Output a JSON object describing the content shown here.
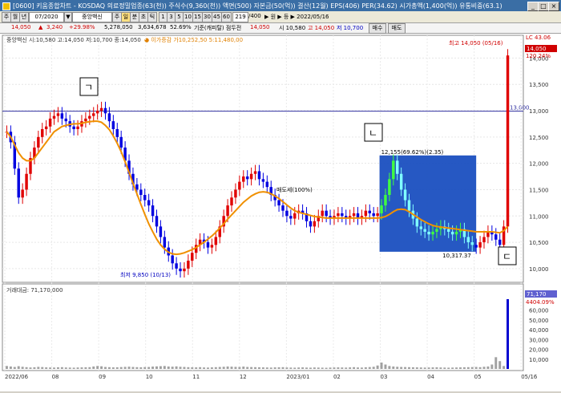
{
  "window": {
    "title": "[0600] 키움종합차트 - KOSDAQ 의료정밀업종(63(천)) 주식수(9,360(천)) 액면(500) 자본금(50(억)) 결산(12월) EPS(406) PER(34.62) 시가총액(1,400(억)) 유통비중(63.1)",
    "buttons": [
      "_",
      "□",
      "×"
    ]
  },
  "toolbar": {
    "period_buttons": [
      "주",
      "월",
      "년"
    ],
    "date": "07/2020",
    "stock_name": "중앙백신",
    "mode_buttons": [
      "주",
      "일",
      "분",
      "초",
      "틱"
    ],
    "minute_buttons": [
      "1",
      "3",
      "5",
      "10",
      "15",
      "30",
      "45",
      "60"
    ],
    "count": "219",
    "count_total": "/400",
    "info": "▶ 원 ▶ 등 ▶ 2022/05/16"
  },
  "pricebar": {
    "last": "14,050",
    "change": "3,240",
    "change_pct": "+29.98%",
    "volume": "5,278,050",
    "amount": "3,634,678",
    "rate": "52.69%",
    "ref_label": "기준(캐피탈) 점두전",
    "hi_label": "14,050",
    "open": "시 10,580",
    "high": "고 14,050",
    "low": "저 10,700",
    "btn1": "매수",
    "btn2": "매도"
  },
  "legend": {
    "price": "중앙백신 시:10,580 고:14,050 저:10,700 종:14,050",
    "ma": "● 이가증감 가10,252,50  5:11,480,00",
    "volume": "거래대금: 71,170,000"
  },
  "chart_data": {
    "type": "candlestick",
    "x_ticks": [
      "2022/06",
      "08",
      "09",
      "10",
      "11",
      "12",
      "2023/01",
      "02",
      "03",
      "04",
      "05",
      "05/16"
    ],
    "y_ticks": [
      "10,000",
      "10,500",
      "11,000",
      "11,500",
      "12,000",
      "12,500",
      "13,000",
      "13,500",
      "14,000"
    ],
    "ylim": [
      9800,
      14250
    ],
    "volume_ticks": [
      "10,000",
      "20,000",
      "30,000",
      "40,000",
      "50,000",
      "60,000"
    ],
    "volume_ylim": [
      0,
      72000
    ],
    "hline": {
      "value": 12990,
      "label": "13,000"
    },
    "annotations": {
      "high": "최고 14,050 (05/16)",
      "low": "최저 9,850 (10/13)",
      "rect_top": "12,155(69.62%)(2.35)",
      "rect_bottom": "10,317.37",
      "mid_label": "매도세(100%)",
      "corner1": "ㄱ",
      "corner2": "ㄴ",
      "corner3": "ㄷ",
      "right_top1": "LC 43.06",
      "right_top2": "14,050",
      "right_top3": "120.24%",
      "vol_right1": "71,170",
      "vol_right2": "4404.09%"
    },
    "closes": [
      12600,
      12400,
      11900,
      11350,
      11500,
      11800,
      12100,
      12300,
      12500,
      12650,
      12700,
      12850,
      12900,
      12950,
      12850,
      12800,
      12700,
      12650,
      12700,
      12800,
      12850,
      12900,
      12950,
      13000,
      13050,
      12950,
      12800,
      12650,
      12500,
      12300,
      12050,
      11800,
      11600,
      11500,
      11400,
      11300,
      11200,
      11000,
      10800,
      10600,
      10400,
      10250,
      10100,
      10000,
      9950,
      10000,
      10150,
      10300,
      10450,
      10550,
      10500,
      10400,
      10450,
      10600,
      10800,
      11000,
      11200,
      11350,
      11500,
      11650,
      11750,
      11700,
      11800,
      11850,
      11700,
      11650,
      11550,
      11400,
      11300,
      11200,
      11100,
      11000,
      10950,
      11050,
      11100,
      11050,
      10900,
      10800,
      10900,
      11000,
      11100,
      11000,
      10950,
      11000,
      11050,
      11000,
      10950,
      11000,
      11050,
      10950,
      11000,
      11100,
      11050,
      11000,
      11050,
      11200,
      11400,
      11700,
      12050,
      11800,
      11500,
      11300,
      11100,
      10950,
      10800,
      10750,
      10700,
      10650,
      10700,
      10750,
      10800,
      10750,
      10700,
      10650,
      10700,
      10750,
      10600,
      10500,
      10450,
      10400,
      10500,
      10600,
      10700,
      10650,
      10550,
      10450,
      10800,
      14050
    ],
    "ma": [
      12600,
      12500,
      12350,
      12200,
      12100,
      12050,
      12050,
      12100,
      12200,
      12300,
      12400,
      12500,
      12600,
      12650,
      12700,
      12720,
      12740,
      12750,
      12750,
      12760,
      12780,
      12790,
      12800,
      12800,
      12780,
      12720,
      12640,
      12520,
      12380,
      12220,
      12030,
      11830,
      11620,
      11420,
      11220,
      11030,
      10850,
      10700,
      10560,
      10450,
      10370,
      10310,
      10280,
      10270,
      10280,
      10300,
      10330,
      10360,
      10400,
      10450,
      10500,
      10560,
      10620,
      10690,
      10770,
      10850,
      10940,
      11020,
      11100,
      11180,
      11260,
      11320,
      11380,
      11420,
      11450,
      11460,
      11450,
      11420,
      11380,
      11330,
      11270,
      11210,
      11150,
      11100,
      11070,
      11050,
      11030,
      11010,
      10990,
      10980,
      10970,
      10960,
      10960,
      10960,
      10960,
      10960,
      10960,
      10960,
      10960,
      10960,
      10960,
      10960,
      10960,
      10960,
      10960,
      10970,
      10990,
      11030,
      11080,
      11120,
      11130,
      11120,
      11080,
      11030,
      10980,
      10930,
      10890,
      10850,
      10820,
      10800,
      10790,
      10780,
      10770,
      10760,
      10750,
      10740,
      10730,
      10720,
      10710,
      10700,
      10700,
      10700,
      10700,
      10700,
      10690,
      10680,
      10720,
      10800
    ],
    "volumes": [
      3000,
      2500,
      2000,
      2800,
      2200,
      1800,
      1500,
      1700,
      2100,
      1900,
      1600,
      1500,
      1400,
      1700,
      1800,
      1500,
      1400,
      1300,
      1500,
      1600,
      1700,
      1800,
      2500,
      3000,
      2700,
      2000,
      1800,
      1600,
      1700,
      1900,
      2100,
      2300,
      2000,
      1800,
      1700,
      1900,
      2000,
      2400,
      2600,
      2800,
      3000,
      2500,
      2300,
      2600,
      2200,
      2000,
      1800,
      1700,
      1600,
      1800,
      1500,
      1400,
      1600,
      1800,
      2000,
      2200,
      2500,
      2300,
      2100,
      2000,
      2400,
      2000,
      1900,
      1800,
      1700,
      1600,
      1500,
      1400,
      1600,
      1700,
      1800,
      1500,
      1400,
      1300,
      1500,
      1600,
      1400,
      1300,
      1500,
      1400,
      1300,
      1200,
      1400,
      1500,
      1600,
      1500,
      1400,
      1600,
      1800,
      1500,
      1400,
      1700,
      1900,
      2200,
      3500,
      6500,
      4500,
      3000,
      2500,
      2200,
      2000,
      1900,
      1800,
      1700,
      1600,
      1500,
      1400,
      1500,
      1600,
      1700,
      1500,
      1400,
      1300,
      1400,
      1500,
      1600,
      1700,
      1800,
      1900,
      2000,
      1800,
      2200,
      2500,
      4500,
      12000,
      8000,
      3000,
      71170
    ]
  }
}
